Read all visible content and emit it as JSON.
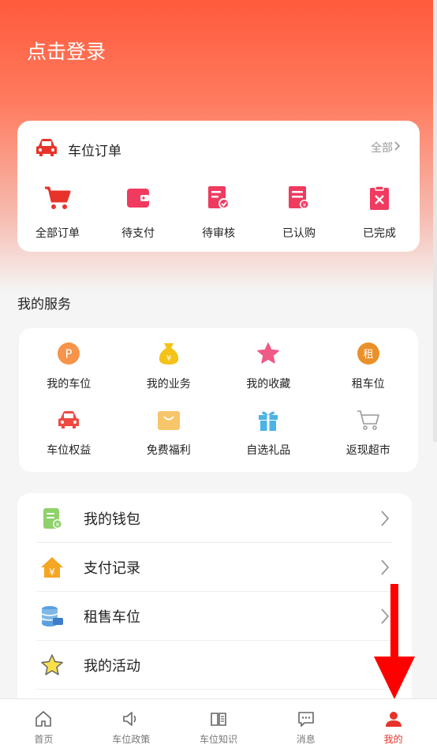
{
  "header": {
    "login_label": "点击登录"
  },
  "orders": {
    "title": "车位订单",
    "all_label": "全部",
    "items": [
      {
        "label": "全部订单",
        "icon": "cart-icon"
      },
      {
        "label": "待支付",
        "icon": "wallet-icon"
      },
      {
        "label": "待审核",
        "icon": "review-doc-icon"
      },
      {
        "label": "已认购",
        "icon": "purchased-doc-icon"
      },
      {
        "label": "已完成",
        "icon": "completed-clipboard-icon"
      }
    ]
  },
  "services": {
    "title": "我的服务",
    "items": [
      {
        "label": "我的车位",
        "icon": "parking-icon"
      },
      {
        "label": "我的业务",
        "icon": "money-bag-icon"
      },
      {
        "label": "我的收藏",
        "icon": "star-icon"
      },
      {
        "label": "租车位",
        "icon": "rent-icon",
        "icon_text": "租"
      },
      {
        "label": "车位权益",
        "icon": "car-icon"
      },
      {
        "label": "免费福利",
        "icon": "shopping-bag-icon"
      },
      {
        "label": "自选礼品",
        "icon": "gift-icon"
      },
      {
        "label": "返现超市",
        "icon": "shopping-cart-icon"
      }
    ]
  },
  "menu": {
    "items": [
      {
        "label": "我的钱包",
        "icon": "wallet-doc-icon"
      },
      {
        "label": "支付记录",
        "icon": "house-yen-icon"
      },
      {
        "label": "租售车位",
        "icon": "coin-stack-icon"
      },
      {
        "label": "我的活动",
        "icon": "activity-star-icon"
      }
    ]
  },
  "tabbar": {
    "items": [
      {
        "label": "首页",
        "icon": "home-icon"
      },
      {
        "label": "车位政策",
        "icon": "speaker-icon"
      },
      {
        "label": "车位知识",
        "icon": "book-icon"
      },
      {
        "label": "消息",
        "icon": "message-icon"
      },
      {
        "label": "我的",
        "icon": "user-icon",
        "active": true
      }
    ]
  },
  "colors": {
    "accent": "#e8332a",
    "header_top": "#ff5a3c"
  }
}
